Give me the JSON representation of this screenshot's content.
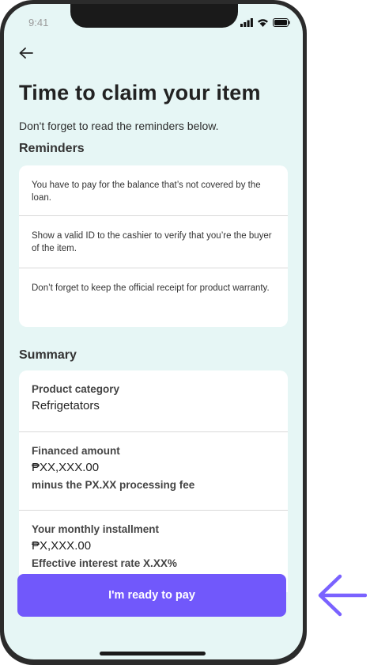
{
  "status": {
    "time": "9:41"
  },
  "header": {
    "back_icon": "arrow-left-icon",
    "title": "Time to claim your item",
    "subtitle": "Don't forget to read the reminders below."
  },
  "reminders": {
    "heading": "Reminders",
    "items": [
      "You have to pay for the balance that’s not covered by the loan.",
      "Show a valid ID to the cashier to verify that you’re the buyer of the item.",
      "Don’t forget to keep the official receipt for product warranty."
    ]
  },
  "summary": {
    "heading": "Summary",
    "product_label": "Product category",
    "product_value": "Refrigetators",
    "financed_label": "Financed amount",
    "financed_value": "₱XX,XXX.00",
    "financed_note": "minus the PX.XX processing fee",
    "installment_label": "Your monthly installment",
    "installment_value": "₱X,XXX.00",
    "installment_note": "Effective interest rate X.XX%"
  },
  "cta": {
    "label": "I'm ready to pay"
  },
  "colors": {
    "accent": "#7158fb",
    "background": "#e6f6f5",
    "pointer": "#7a62ff"
  }
}
